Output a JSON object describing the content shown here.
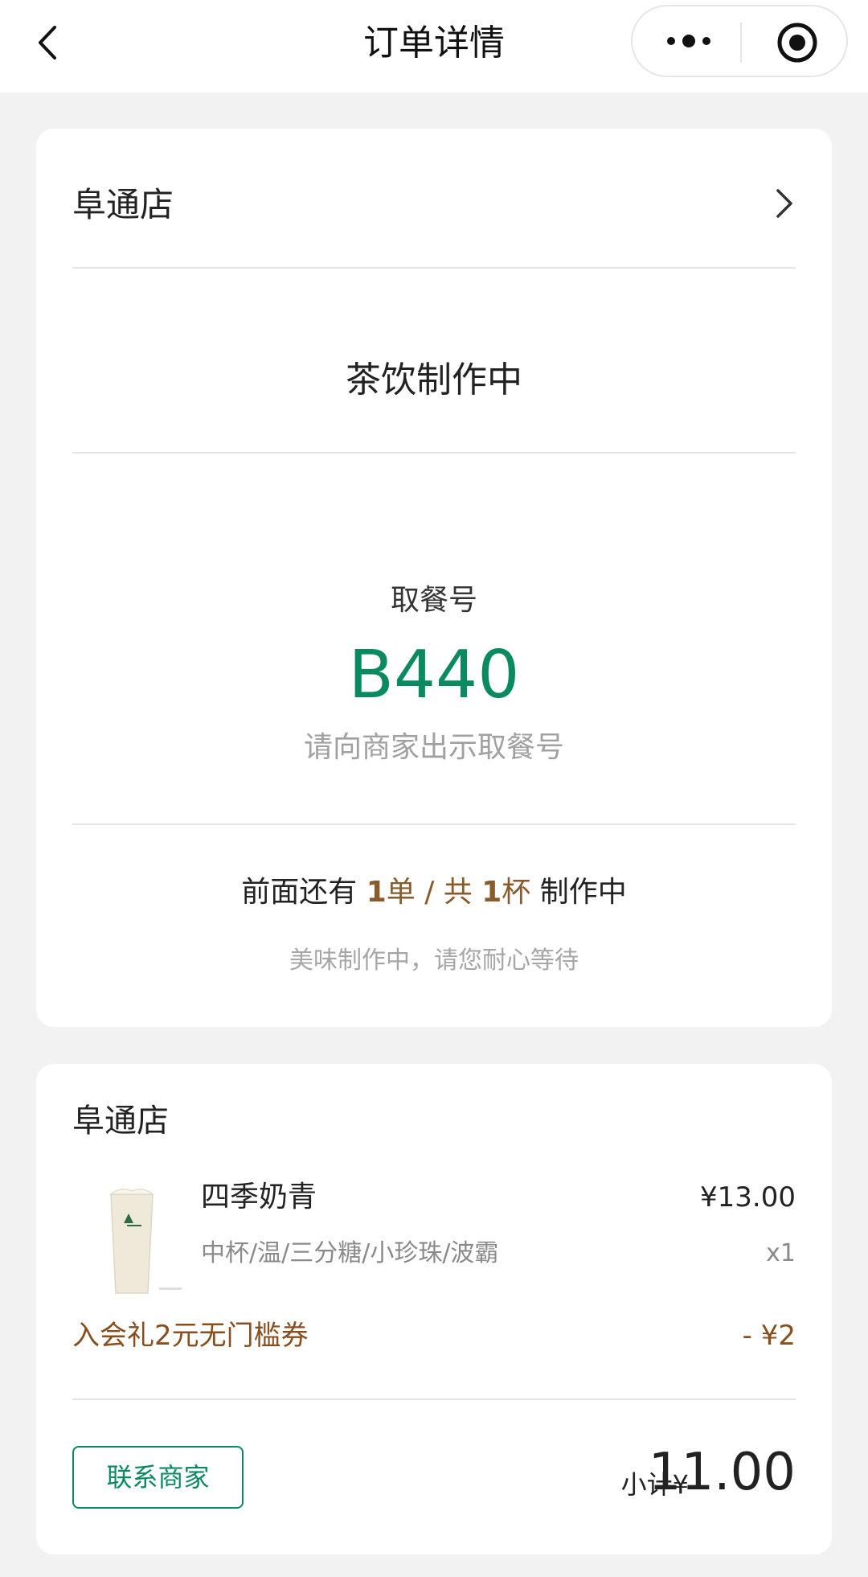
{
  "navbar": {
    "title": "订单详情",
    "back_icon": "chevron-left-icon",
    "more_icon": "more-dots-icon",
    "close_icon": "target-circle-icon"
  },
  "order": {
    "store": "阜通店",
    "status": "茶饮制作中",
    "pickup_label": "取餐号",
    "pickup_number": "B440",
    "pickup_hint": "请向商家出示取餐号",
    "queue": {
      "prefix": "前面还有 ",
      "orders_count": "1",
      "orders_unit": "单 / 共 ",
      "cups_count": "1",
      "cups_unit": "杯",
      "suffix": " 制作中"
    },
    "queue_hint": "美味制作中，请您耐心等待"
  },
  "detail": {
    "store": "阜通店",
    "item": {
      "name": "四季奶青",
      "price": "¥13.00",
      "spec": "中杯/温/三分糖/小珍珠/波霸",
      "qty": "x1"
    },
    "coupon": {
      "name": "入会礼2元无门槛券",
      "amount": "- ¥2"
    },
    "contact_label": "联系商家",
    "subtotal_label": "小计¥",
    "subtotal_value": "11.00"
  },
  "colors": {
    "brand_green": "#0a8a5f",
    "highlight_brown": "#8a5a2b",
    "background": "#f2f2f2"
  }
}
